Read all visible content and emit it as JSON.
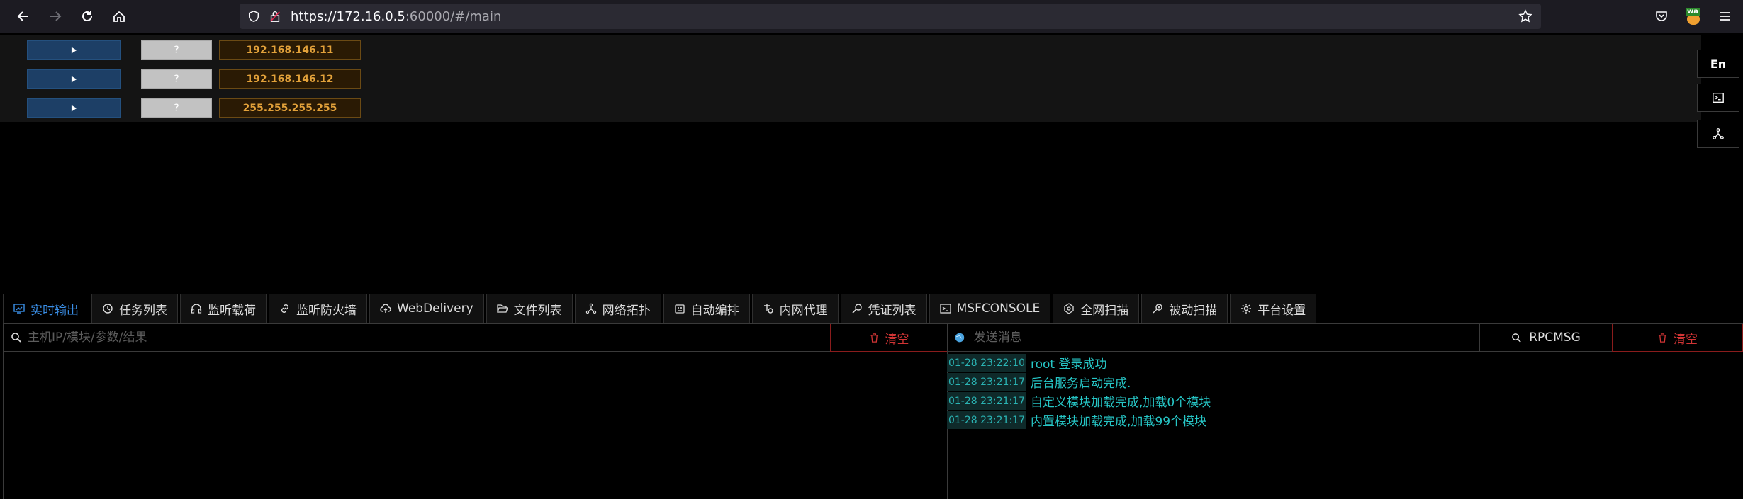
{
  "browser": {
    "url_host": "https://172.16.0.5",
    "url_rest": ":60000/#/main",
    "extension_badge": "wa"
  },
  "hosts": [
    {
      "status": "?",
      "ip": "192.168.146.11"
    },
    {
      "status": "?",
      "ip": "192.168.146.12"
    },
    {
      "status": "?",
      "ip": "255.255.255.255"
    }
  ],
  "side": {
    "lang_label": "En"
  },
  "tabs": [
    {
      "label": "实时输出",
      "icon": "monitor-icon",
      "active": true
    },
    {
      "label": "任务列表",
      "icon": "clock-icon"
    },
    {
      "label": "监听载荷",
      "icon": "headset-icon"
    },
    {
      "label": "监听防火墙",
      "icon": "link-icon"
    },
    {
      "label": "WebDelivery",
      "icon": "cloud-upload-icon"
    },
    {
      "label": "文件列表",
      "icon": "folder-open-icon"
    },
    {
      "label": "网络拓扑",
      "icon": "topology-icon"
    },
    {
      "label": "自动编排",
      "icon": "robot-icon"
    },
    {
      "label": "内网代理",
      "icon": "proxy-icon"
    },
    {
      "label": "凭证列表",
      "icon": "key-search-icon"
    },
    {
      "label": "MSFCONSOLE",
      "icon": "terminal-icon"
    },
    {
      "label": "全网扫描",
      "icon": "radar-icon"
    },
    {
      "label": "被动扫描",
      "icon": "zoom-icon"
    },
    {
      "label": "平台设置",
      "icon": "gear-icon"
    }
  ],
  "left_panel": {
    "search_placeholder": "主机IP/模块/参数/结果",
    "clear_label": "清空"
  },
  "right_panel": {
    "message_placeholder": "发送消息",
    "rpc_label": "RPCMSG",
    "clear_label": "清空",
    "logs": [
      {
        "time": "01-28 23:22:10",
        "text": "root 登录成功"
      },
      {
        "time": "01-28 23:21:17",
        "text": "后台服务启动完成."
      },
      {
        "time": "01-28 23:21:17",
        "text": "自定义模块加载完成,加载0个模块"
      },
      {
        "time": "01-28 23:21:17",
        "text": "内置模块加载完成,加载99个模块"
      }
    ]
  }
}
